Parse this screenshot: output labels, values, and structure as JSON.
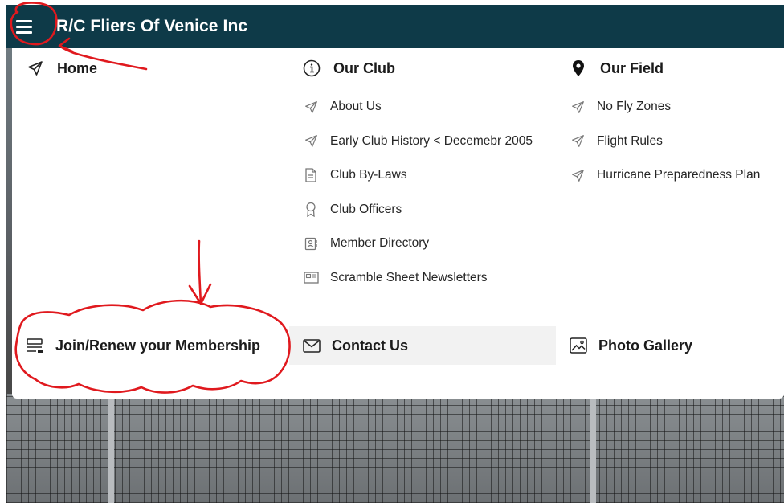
{
  "header": {
    "site_title": "R/C Fliers Of Venice Inc"
  },
  "menu": {
    "home": {
      "label": "Home",
      "icon": "paper-plane-icon"
    },
    "our_club": {
      "label": "Our Club",
      "icon": "info-circle-icon",
      "items": [
        {
          "label": "About Us",
          "icon": "paper-plane-icon"
        },
        {
          "label": "Early Club History < Decemebr 2005",
          "icon": "paper-plane-icon"
        },
        {
          "label": "Club By-Laws",
          "icon": "document-icon"
        },
        {
          "label": "Club Officers",
          "icon": "award-ribbon-icon"
        },
        {
          "label": "Member Directory",
          "icon": "contact-card-icon"
        },
        {
          "label": "Scramble Sheet Newsletters",
          "icon": "newspaper-icon"
        }
      ]
    },
    "our_field": {
      "label": "Our Field",
      "icon": "map-pin-icon",
      "items": [
        {
          "label": "No Fly Zones",
          "icon": "paper-plane-icon"
        },
        {
          "label": "Flight Rules",
          "icon": "paper-plane-icon"
        },
        {
          "label": "Hurricane Preparedness Plan",
          "icon": "paper-plane-icon"
        }
      ]
    },
    "join": {
      "label": "Join/Renew your Membership",
      "icon": "form-list-icon"
    },
    "contact": {
      "label": "Contact Us",
      "icon": "envelope-icon"
    },
    "gallery": {
      "label": "Photo Gallery",
      "icon": "image-icon"
    }
  },
  "colors": {
    "header_bg": "#0e3a48",
    "annotation": "#e0191e",
    "hover_bg": "#f2f2f2"
  }
}
